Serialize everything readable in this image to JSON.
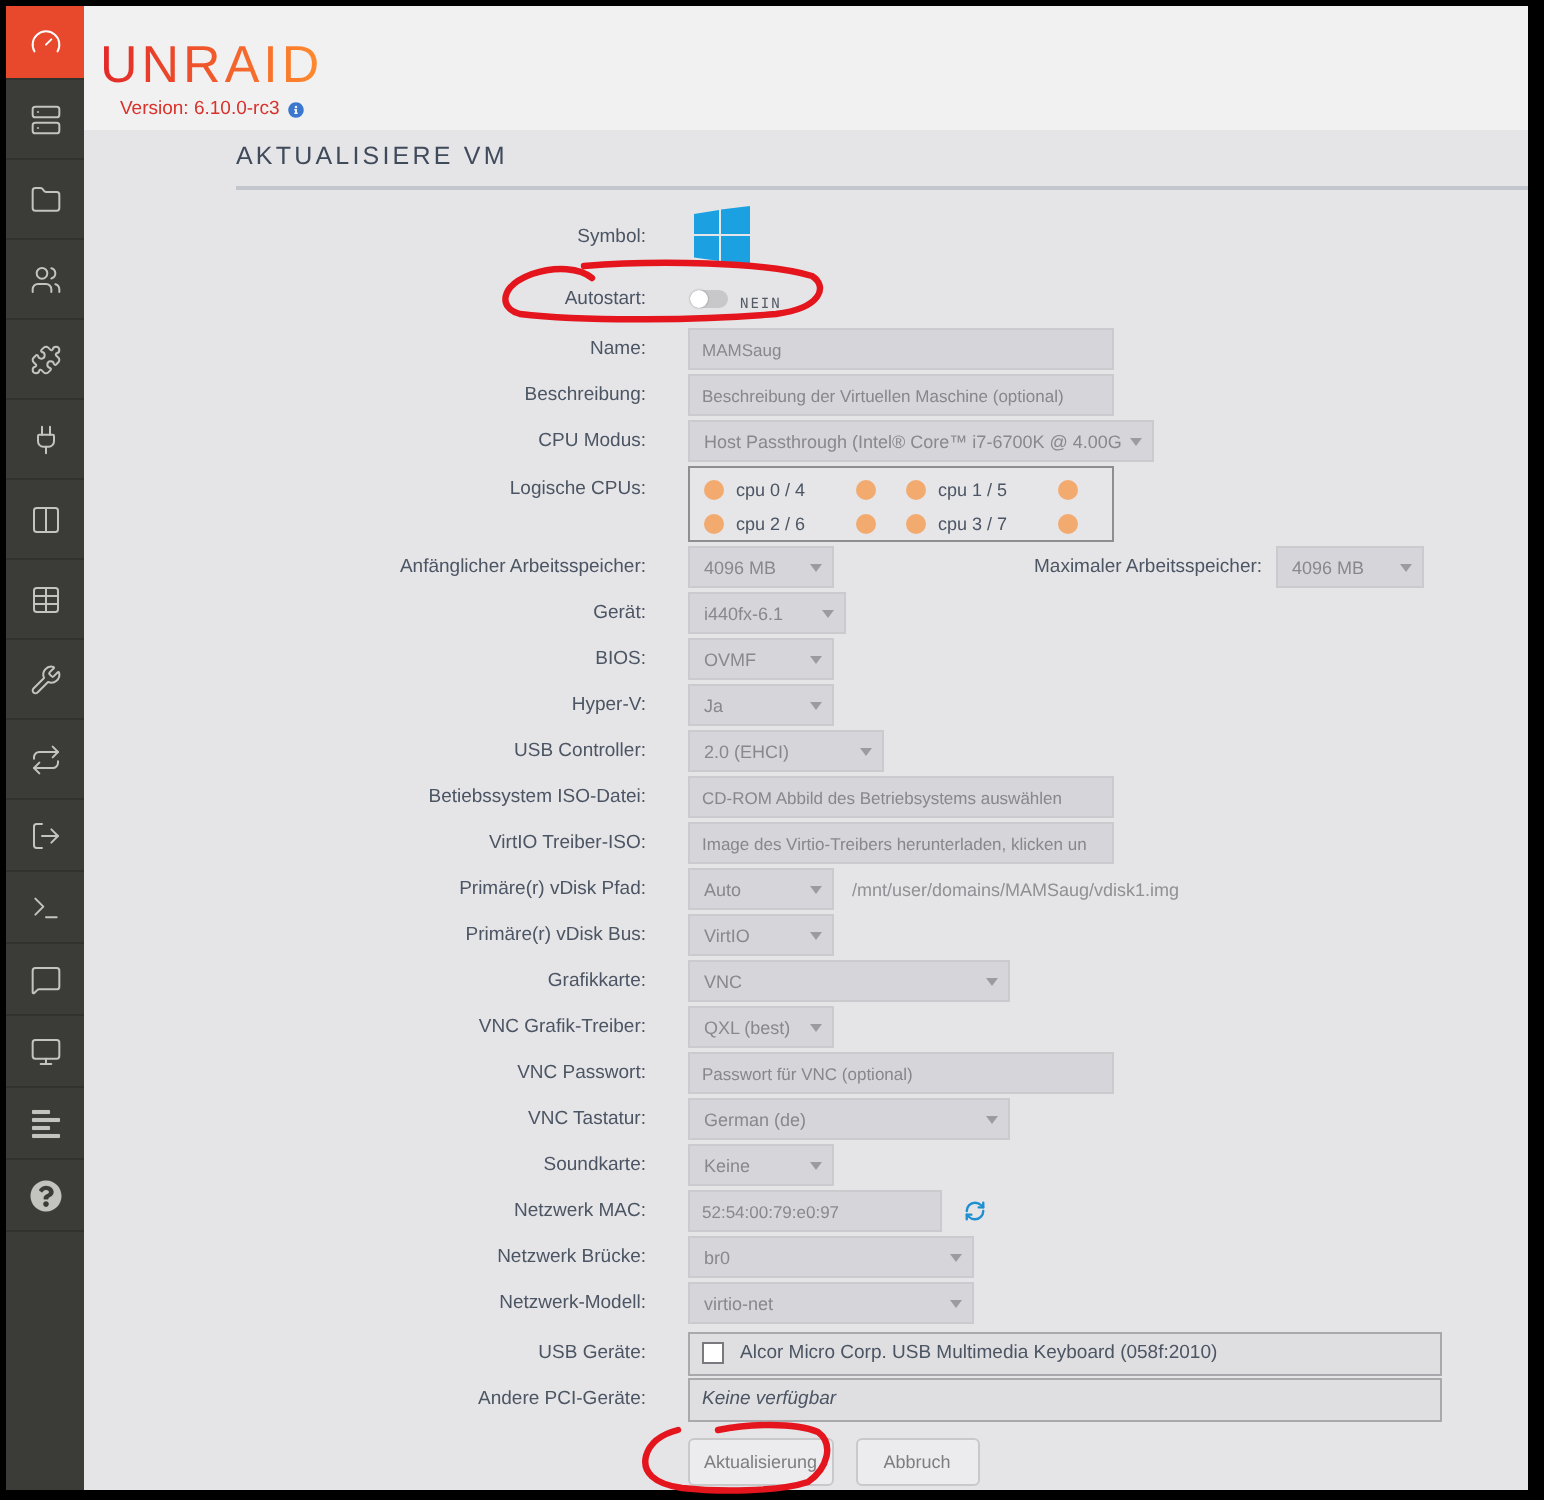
{
  "sidebar": {
    "items": [
      {
        "selected": true
      },
      {
        "selected": false
      },
      {
        "selected": false
      },
      {
        "selected": false
      },
      {
        "selected": false
      },
      {
        "selected": false
      },
      {
        "selected": false
      },
      {
        "selected": false
      },
      {
        "selected": false
      },
      {
        "selected": false
      },
      {
        "selected": false
      },
      {
        "selected": false
      },
      {
        "selected": false
      },
      {
        "selected": false
      },
      {
        "selected": false
      },
      {
        "selected": false
      }
    ]
  },
  "header": {
    "logo": "UNRAID",
    "version": "Version: 6.10.0-rc3"
  },
  "page": {
    "title": "AKTUALISIERE VM",
    "fields_disabled": true
  },
  "form": {
    "rows": [
      {
        "kind": "icon",
        "label": "Symbol:"
      },
      {
        "kind": "toggle",
        "label": "Autostart:",
        "on": false,
        "state_label": "NEIN",
        "circled": true
      },
      {
        "kind": "input",
        "label": "Name:",
        "value": "MAMSaug"
      },
      {
        "kind": "input",
        "label": "Beschreibung:",
        "placeholder": "Beschreibung der Virtuellen Maschine (optional)"
      },
      {
        "kind": "select",
        "label": "CPU Modus:",
        "value": "Host Passthrough (Intel® Core™ i7-6700K @ 4.00G"
      },
      {
        "kind": "cpus",
        "label": "Logische CPUs:",
        "cpus": [
          {
            "label": "cpu 0 / 4"
          },
          {
            "label": "cpu 1 / 5"
          },
          {
            "label": "cpu 2 / 6"
          },
          {
            "label": "cpu 3 / 7"
          }
        ]
      },
      {
        "kind": "select",
        "label": "Anfänglicher Arbeitsspeicher:",
        "value": "4096 MB",
        "extra": {
          "label": "Maximaler Arbeitsspeicher:",
          "value": "4096 MB"
        }
      },
      {
        "kind": "select",
        "label": "Gerät:",
        "value": "i440fx-6.1"
      },
      {
        "kind": "select",
        "label": "BIOS:",
        "value": "OVMF"
      },
      {
        "kind": "select",
        "label": "Hyper-V:",
        "value": "Ja"
      },
      {
        "kind": "select",
        "label": "USB Controller:",
        "value": "2.0 (EHCI)"
      },
      {
        "kind": "input",
        "label": "Betiebssystem ISO-Datei:",
        "placeholder": "CD-ROM Abbild des Betriebsystems auswählen"
      },
      {
        "kind": "input",
        "label": "VirtIO Treiber-ISO:",
        "placeholder": "Image des Virtio-Treibers herunterladen, klicken un"
      },
      {
        "kind": "select",
        "label": "Primäre(r) vDisk Pfad:",
        "value": "Auto",
        "path": "/mnt/user/domains/MAMSaug/vdisk1.img"
      },
      {
        "kind": "select",
        "label": "Primäre(r) vDisk Bus:",
        "value": "VirtIO"
      },
      {
        "kind": "select",
        "label": "Grafikkarte:",
        "value": "VNC"
      },
      {
        "kind": "select",
        "label": "VNC Grafik-Treiber:",
        "value": "QXL (best)"
      },
      {
        "kind": "input",
        "label": "VNC Passwort:",
        "placeholder": "Passwort für VNC (optional)"
      },
      {
        "kind": "select",
        "label": "VNC Tastatur:",
        "value": "German (de)"
      },
      {
        "kind": "select",
        "label": "Soundkarte:",
        "value": "Keine"
      },
      {
        "kind": "input",
        "label": "Netzwerk MAC:",
        "value": "52:54:00:79:e0:97",
        "refresh": true
      },
      {
        "kind": "select",
        "label": "Netzwerk Brücke:",
        "value": "br0"
      },
      {
        "kind": "select",
        "label": "Netzwerk-Modell:",
        "value": "virtio-net"
      },
      {
        "kind": "checklist",
        "label": "USB Geräte:",
        "items": [
          {
            "label": "Alcor Micro Corp. USB Multimedia Keyboard (058f:2010)",
            "checked": false
          }
        ]
      },
      {
        "kind": "note",
        "label": "Andere PCI-Geräte:",
        "text": "Keine verfügbar"
      }
    ]
  },
  "buttons": [
    {
      "label": "Aktualisierung",
      "circled": true
    },
    {
      "label": "Abbruch",
      "circled": false
    }
  ]
}
